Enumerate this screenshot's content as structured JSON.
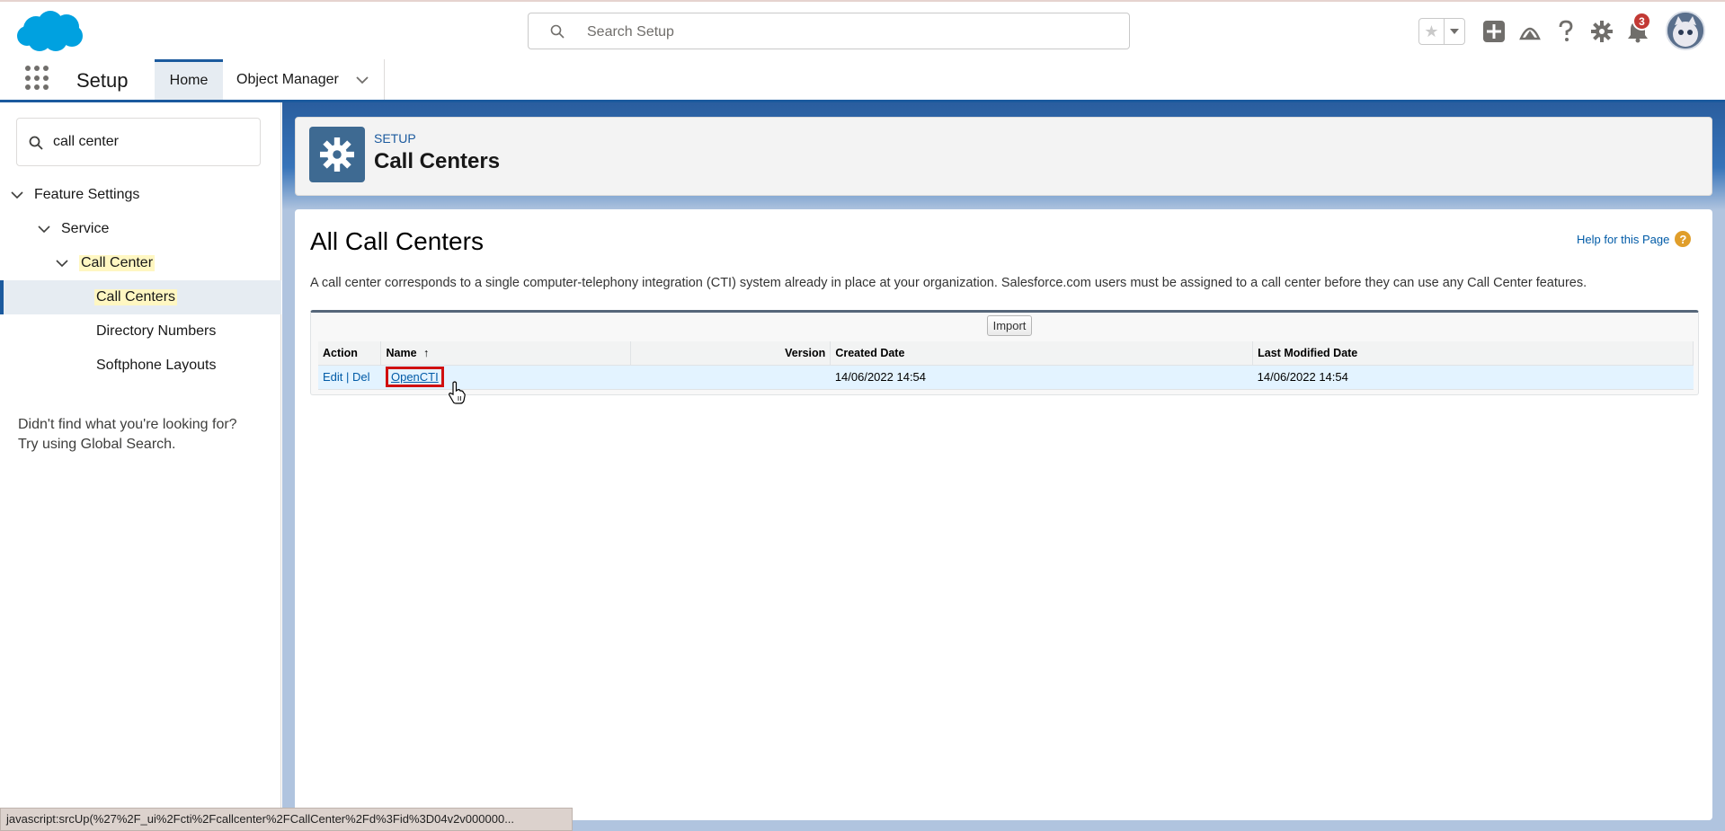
{
  "header": {
    "search_placeholder": "Search Setup",
    "notification_count": "3",
    "brand_color": "#00a1e0"
  },
  "context_bar": {
    "app_name": "Setup",
    "tabs": [
      {
        "label": "Home",
        "active": true
      },
      {
        "label": "Object Manager",
        "active": false
      }
    ]
  },
  "sidebar": {
    "quick_find_value": "call center",
    "tree": {
      "feature_settings": "Feature Settings",
      "service": "Service",
      "call_center": "Call Center",
      "call_centers": "Call Centers",
      "directory_numbers": "Directory Numbers",
      "softphone_layouts": "Softphone Layouts"
    },
    "help_line1": "Didn't find what you're looking for?",
    "help_line2": "Try using Global Search."
  },
  "page_header": {
    "eyebrow": "SETUP",
    "title": "Call Centers"
  },
  "content": {
    "title": "All Call Centers",
    "help_link": "Help for this Page",
    "description": "A call center corresponds to a single computer-telephony integration (CTI) system already in place at your organization. Salesforce.com users must be assigned to a call center before they can use any Call Center features.",
    "import_button": "Import",
    "columns": {
      "action": "Action",
      "name": "Name",
      "sort_arrow": "↑",
      "version": "Version",
      "created": "Created Date",
      "modified": "Last Modified Date"
    },
    "rows": [
      {
        "edit": "Edit",
        "separator": "|",
        "del": "Del",
        "name": "OpenCTI",
        "version": "",
        "created": "14/06/2022 14:54",
        "modified": "14/06/2022 14:54"
      }
    ]
  },
  "status_bar": {
    "text": "javascript:srcUp(%27%2F_ui%2Fcti%2Fcallcenter%2FCallCenter%2Fd%3Fid%3D04v2v000000..."
  }
}
